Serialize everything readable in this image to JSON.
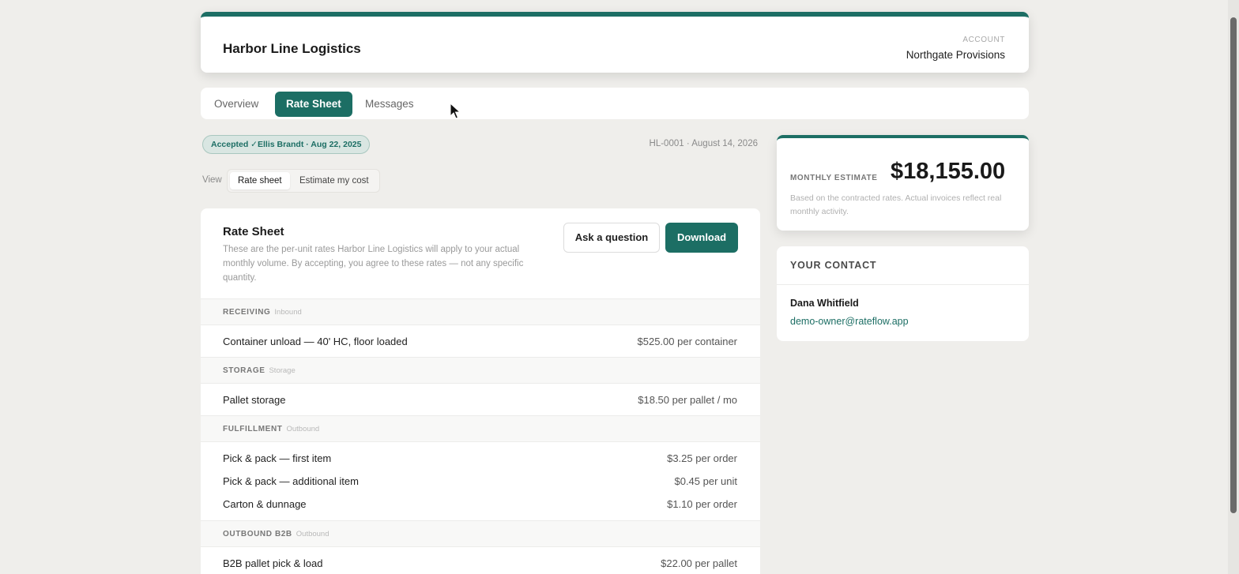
{
  "header": {
    "brand": "Harbor Line Logistics",
    "account_label": "ACCOUNT",
    "account_name": "Northgate Provisions"
  },
  "tabs": [
    {
      "label": "Overview",
      "active": false
    },
    {
      "label": "Rate Sheet",
      "active": true
    },
    {
      "label": "Messages",
      "active": false
    }
  ],
  "status": {
    "badge": "Accepted ✓Ellis Brandt · Aug 22, 2025",
    "reference": "HL-0001 · August 14, 2026"
  },
  "view": {
    "label": "View",
    "options": [
      "Rate sheet",
      "Estimate my cost"
    ],
    "selected": "Rate sheet"
  },
  "sheet": {
    "title": "Rate Sheet",
    "description": "These are the per-unit rates Harbor Line Logistics will apply to your actual monthly volume. By accepting, you agree to these rates — not any specific quantity.",
    "ask_label": "Ask a question",
    "download_label": "Download",
    "sections": [
      {
        "name": "RECEIVING",
        "tag": "Inbound",
        "rows": [
          {
            "label": "Container unload — 40' HC, floor loaded",
            "value": "$525.00 per container"
          }
        ]
      },
      {
        "name": "STORAGE",
        "tag": "Storage",
        "rows": [
          {
            "label": "Pallet storage",
            "value": "$18.50 per pallet / mo"
          }
        ]
      },
      {
        "name": "FULFILLMENT",
        "tag": "Outbound",
        "rows": [
          {
            "label": "Pick & pack — first item",
            "value": "$3.25 per order"
          },
          {
            "label": "Pick & pack — additional item",
            "value": "$0.45 per unit"
          },
          {
            "label": "Carton & dunnage",
            "value": "$1.10 per order"
          }
        ]
      },
      {
        "name": "OUTBOUND B2B",
        "tag": "Outbound",
        "rows": [
          {
            "label": "B2B pallet pick & load",
            "value": "$22.00 per pallet"
          }
        ]
      }
    ]
  },
  "estimate": {
    "label": "MONTHLY ESTIMATE",
    "value": "$18,155.00",
    "note": "Based on the contracted rates. Actual invoices reflect real monthly activity."
  },
  "contact": {
    "heading": "YOUR CONTACT",
    "name": "Dana Whitfield",
    "email": "demo-owner@rateflow.app"
  },
  "colors": {
    "accent": "#1c6e64",
    "background": "#efeeeb"
  }
}
